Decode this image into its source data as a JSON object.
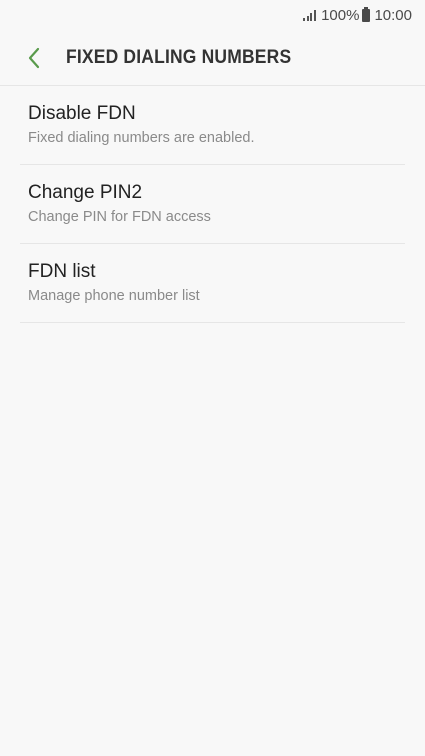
{
  "status_bar": {
    "battery_percent": "100%",
    "time": "10:00",
    "icons": [
      "signal-icon",
      "battery-icon"
    ]
  },
  "header": {
    "title": "FIXED DIALING NUMBERS",
    "back_icon": "chevron-left-icon",
    "accent_color": "#5a9b4c"
  },
  "items": [
    {
      "title": "Disable FDN",
      "subtitle": "Fixed dialing numbers are enabled."
    },
    {
      "title": "Change PIN2",
      "subtitle": "Change PIN for FDN access"
    },
    {
      "title": "FDN list",
      "subtitle": "Manage phone number list"
    }
  ]
}
